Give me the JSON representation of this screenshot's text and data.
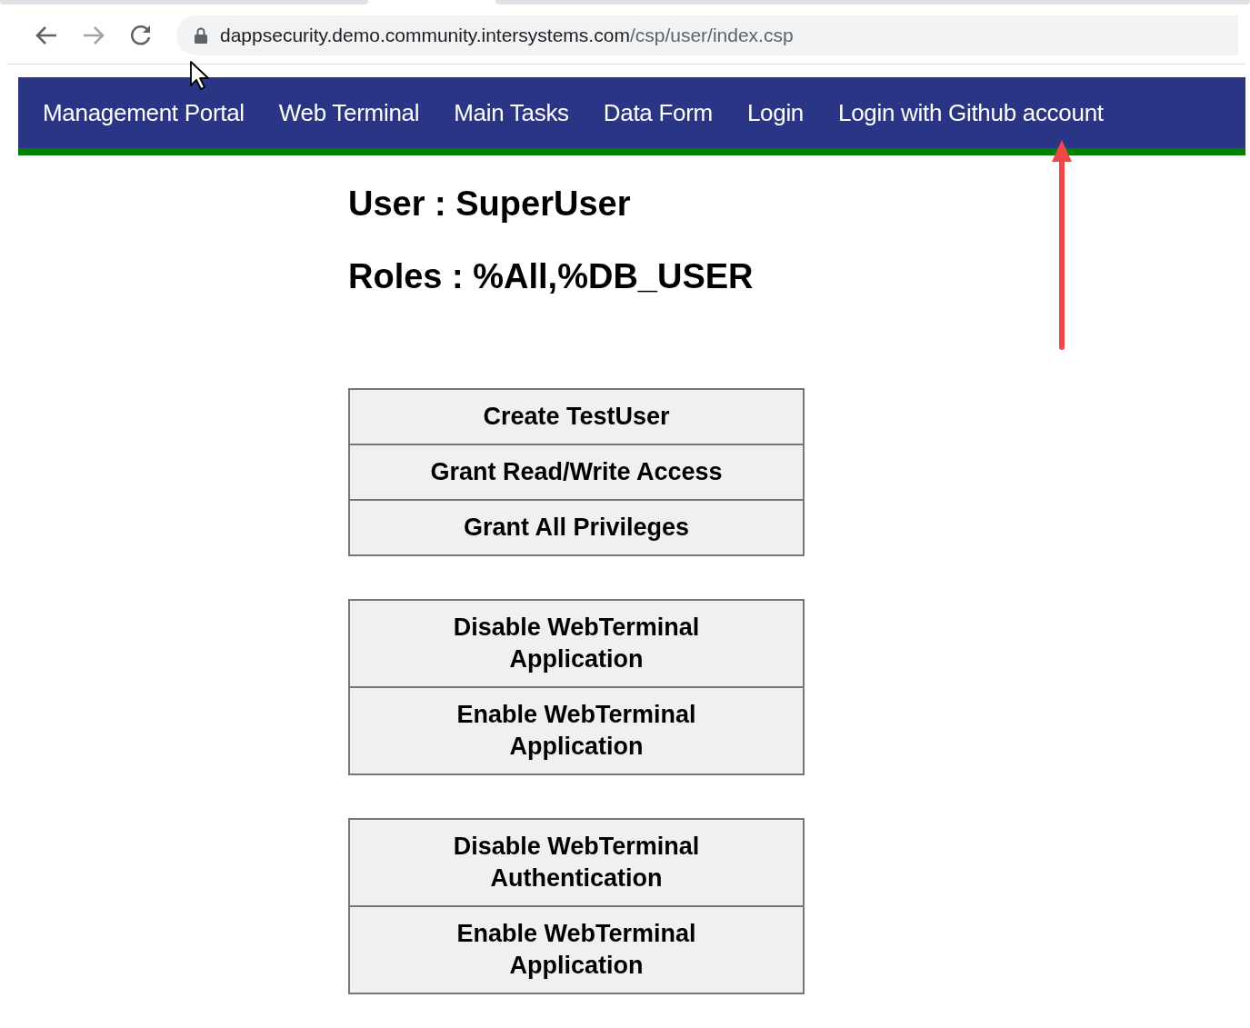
{
  "browser": {
    "url": {
      "host": "dappsecurity.demo.community.intersystems.com",
      "path": "/csp/user/index.csp"
    }
  },
  "nav": {
    "items": [
      {
        "label": "Management Portal"
      },
      {
        "label": "Web Terminal"
      },
      {
        "label": "Main Tasks"
      },
      {
        "label": "Data Form"
      },
      {
        "label": "Login"
      },
      {
        "label": "Login with Github account"
      }
    ]
  },
  "user": {
    "user_line": "User : SuperUser",
    "roles_line": "Roles : %All,%DB_USER"
  },
  "button_groups": [
    {
      "buttons": [
        "Create TestUser",
        "Grant Read/Write Access",
        "Grant All Privileges"
      ]
    },
    {
      "buttons": [
        "Disable WebTerminal Application",
        "Enable WebTerminal Application"
      ]
    },
    {
      "buttons": [
        "Disable WebTerminal Authentication",
        "Enable WebTerminal Application"
      ]
    }
  ]
}
